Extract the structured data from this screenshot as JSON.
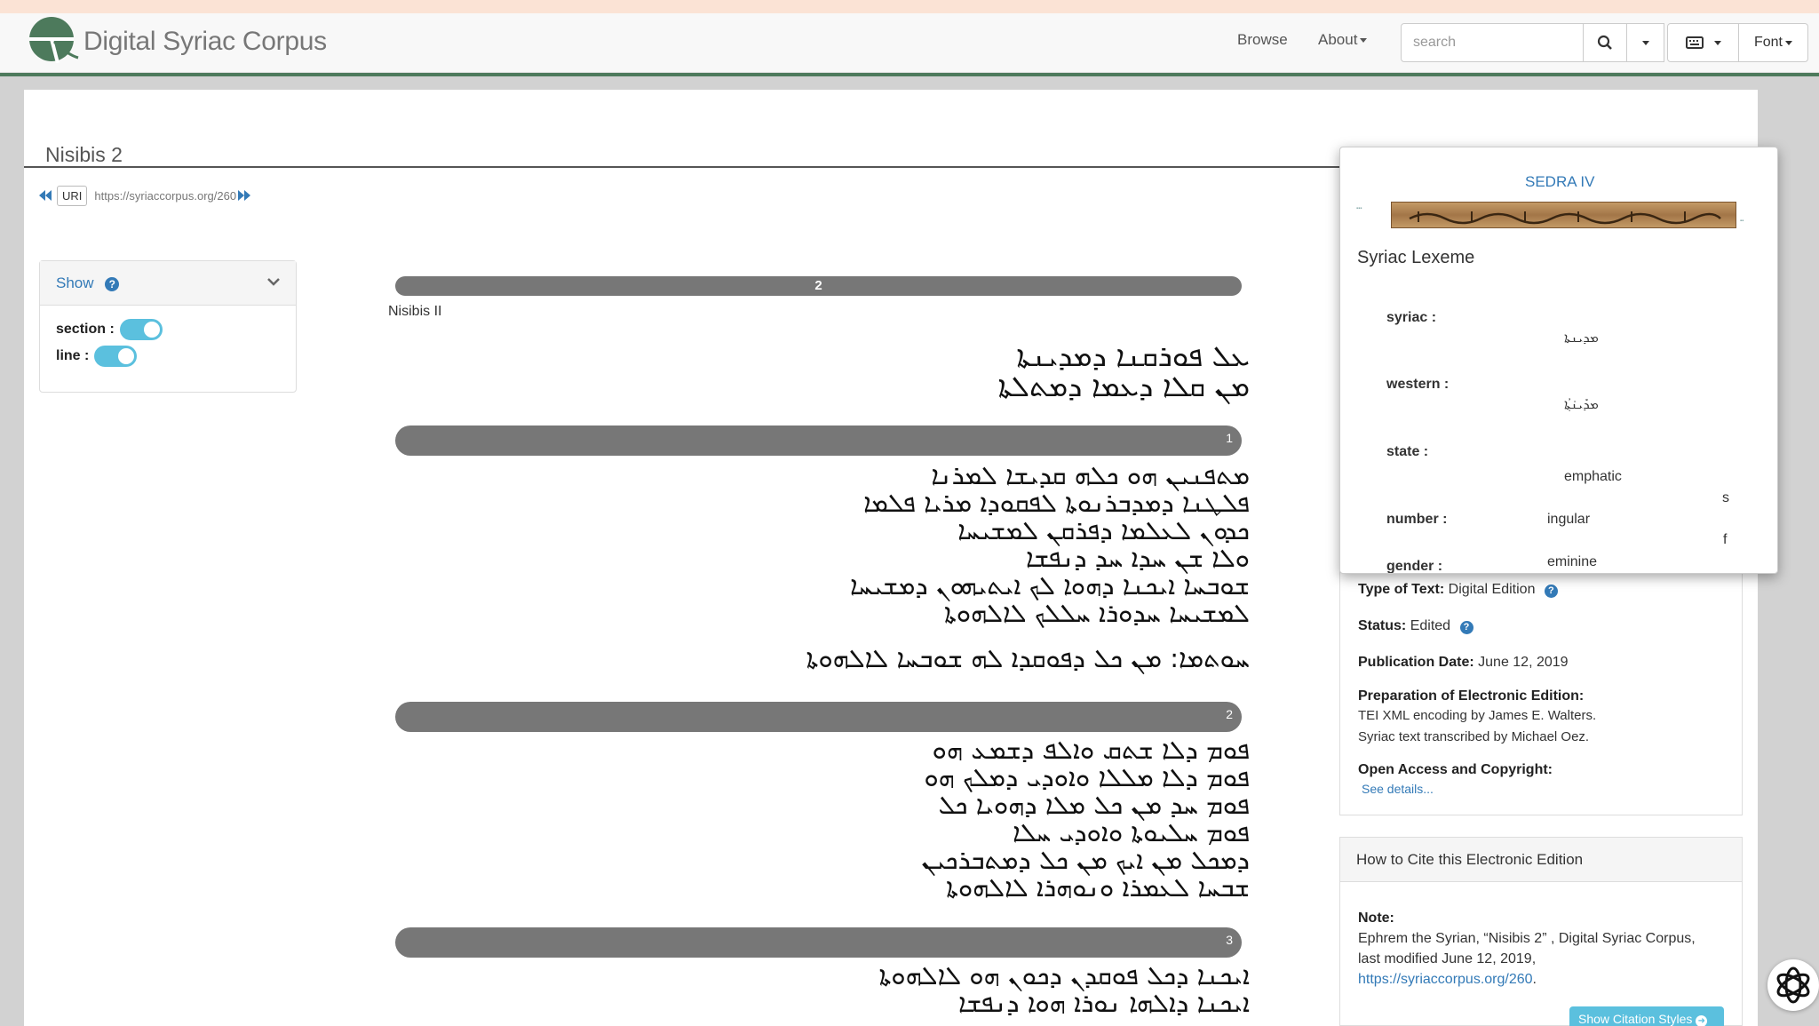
{
  "header": {
    "brand": "Digital Syriac Corpus",
    "nav": {
      "browse": "Browse",
      "about": "About"
    },
    "search": {
      "placeholder": "search"
    },
    "font_label": "Font"
  },
  "page": {
    "title": "Nisibis 2",
    "uri_label": "URI",
    "uri": "https://syriaccorpus.org/260"
  },
  "show_panel": {
    "title": "Show",
    "section_label": "section :",
    "line_label": "line :"
  },
  "text": {
    "top_bar": "2",
    "work_title": "Nisibis II",
    "heading_lines": [
      "ܥܠ ܦܘܪܩܢܐ ܕܡܕܝܢܬܐ",
      "ܡܢ ܩܠܐ ܕܥܡܐ ܕܡܬܠܬܐ"
    ],
    "sections": [
      {
        "num": "1",
        "lines": [
          "ܡܬܦܢܝܢ ܗܘ ܟܠܗ ܩܕܝܫܐ ܠܡܪܢܐ",
          "ܦܠܛܢܐ ܕܡܕܒܪܢܘܬܐ ܠܦܩܘܕܐ ܡܪܝܐ ܦܠܡܐ",
          "ܟܕܘܢ ܠܥܠܡܐ ܕܦܪܩܢ ܠܡܫܝܚܐ",
          "ܘܠܐ ܫܢ ܚܕܐ ܚܕ ܕܢܦܫܐ",
          "ܫܘܒܚܐ ܐܝܟܢܐ ܕܗܘܐ ܠܟ ܐܝܬܝܗܘܢ ܕܡܫܝܚܐ",
          "ܠܡܫܝܚܐ ܚܕܘܪܐ ܚܠܠܟ ܠܐܠܗܘܬܐ",
          "ܚܘܬܡܐ: ܡܢ ܟܠ ܕܦܘܩܕܐ ܠܗ ܫܘܒܚܐ ܠܐܠܗܘܬܐ"
        ]
      },
      {
        "num": "2",
        "lines": [
          "ܦܘܡ ܕܠܐ ܫܬܩ ܘܐܠܦ ܕܫܡܥ ܗܘ",
          "ܦܘܡ ܕܠܐ ܡܠܠܐ ܘܐܘܕܝ ܕܡܠܟ ܗܘ",
          "ܦܘܡ ܚܕ ܡܢ ܟܠ ܡܠܐ ܕܗܘܝܐ ܟܠ",
          "ܦܘܡ ܚܠܝܘܬܐ ܘܐܘܕܝ ܚܠܐ",
          "ܕܡܟܠ ܡܢ ܐܝܟ ܡܢ ܟܠ ܕܡܬܒܪܟܝܢ",
          "ܫܒܚܐ ܠܥܡܪܐ ܘܢܘܗܪܐ ܠܐܠܗܘܬܐ"
        ]
      },
      {
        "num": "3",
        "lines": [
          "ܐܝܟܢܐ ܕܟܠ ܦܘܩܕܢ ܕܟܘܢ ܗܘ ܠܐܠܗܘܬܐ",
          "ܐܝܟܢܐ ܕܐܠܗܐ ܢܘܪܐ ܗܘܐ ܕܢܦܫܐ"
        ]
      }
    ]
  },
  "lexeme_popup": {
    "source_title": "SEDRA IV",
    "heading": "Syriac Lexeme",
    "fields": [
      {
        "label": "syriac :",
        "value": "ܡܕܝܢܬܐ"
      },
      {
        "label": "western :",
        "value": "ܡܕܺܝܢ݁ܬ݂ܳܐ"
      },
      {
        "label": "state :",
        "value": "emphatic"
      },
      {
        "label": "number :",
        "value": "ingular",
        "extra": "s"
      },
      {
        "label": "gender :",
        "value": "eminine",
        "extra": "f"
      }
    ]
  },
  "meta_card": {
    "type_label": "Type of Text:",
    "type_value": "Digital Edition",
    "status_label": "Status:",
    "status_value": "Edited",
    "pub_label": "Publication Date:",
    "pub_value": "June 12, 2019",
    "prep_label": "Preparation of Electronic Edition:",
    "prep_line1": "TEI XML encoding by James E. Walters.",
    "prep_line2": "Syriac text transcribed by Michael Oez.",
    "open_label": "Open Access and Copyright:",
    "see_details": "See details..."
  },
  "cite_card": {
    "heading": "How to Cite this Electronic Edition",
    "note_label": "Note:",
    "note_line1": "Ephrem the Syrian, “Nisibis 2” , Digital Syriac Corpus,",
    "note_line2": "last modified June 12, 2019,",
    "note_link": "https://syriaccorpus.org/260",
    "note_end": ".",
    "button": "Show Citation Styles"
  },
  "colors": {
    "accent": "#337ab7",
    "info": "#5bc0de",
    "brand_green": "#4d7a5c",
    "bar_gray": "#777777"
  }
}
